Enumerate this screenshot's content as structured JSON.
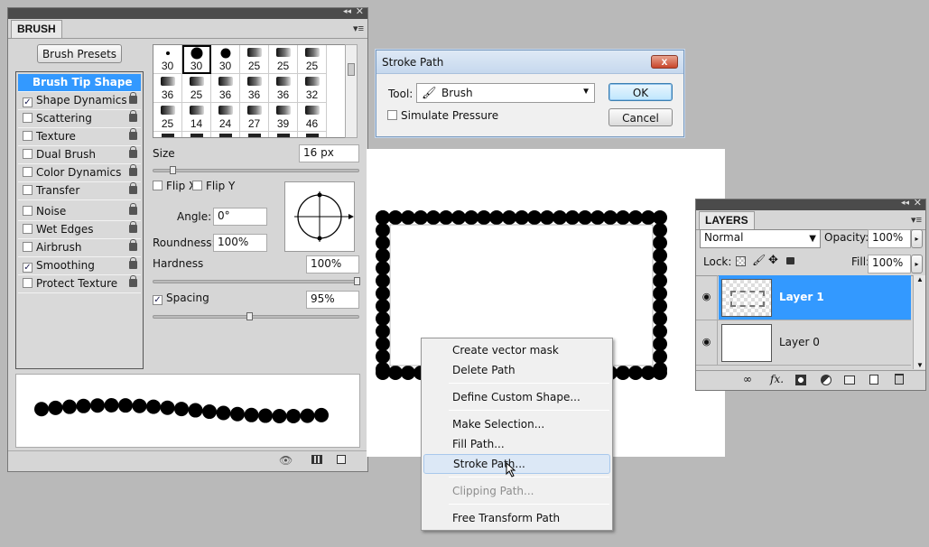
{
  "brush_panel": {
    "tab_label": "BRUSH",
    "presets_button": "Brush Presets",
    "options": [
      {
        "label": "Brush Tip Shape",
        "checked": null,
        "lock": false,
        "selected": true
      },
      {
        "label": "Shape Dynamics",
        "checked": true,
        "lock": true
      },
      {
        "label": "Scattering",
        "checked": false,
        "lock": true
      },
      {
        "label": "Texture",
        "checked": false,
        "lock": true
      },
      {
        "label": "Dual Brush",
        "checked": false,
        "lock": true
      },
      {
        "label": "Color Dynamics",
        "checked": false,
        "lock": true
      },
      {
        "label": "Transfer",
        "checked": false,
        "lock": true
      },
      {
        "label": "Noise",
        "checked": false,
        "lock": true
      },
      {
        "label": "Wet Edges",
        "checked": false,
        "lock": true
      },
      {
        "label": "Airbrush",
        "checked": false,
        "lock": true
      },
      {
        "label": "Smoothing",
        "checked": true,
        "lock": true
      },
      {
        "label": "Protect Texture",
        "checked": false,
        "lock": true
      }
    ],
    "tips_row1": [
      "30",
      "30",
      "30",
      "25",
      "25",
      "25"
    ],
    "tips_row2": [
      "36",
      "25",
      "36",
      "36",
      "36",
      "32"
    ],
    "tips_row3": [
      "25",
      "14",
      "24",
      "27",
      "39",
      "46"
    ],
    "size_label": "Size",
    "size_value": "16 px",
    "size_level": 0.08,
    "flip_x": "Flip X",
    "flip_y": "Flip Y",
    "angle_label": "Angle:",
    "angle_value": "0°",
    "roundness_label": "Roundness:",
    "roundness_value": "100%",
    "hardness_label": "Hardness",
    "hardness_value": "100%",
    "spacing_label": "Spacing",
    "spacing_value": "95%",
    "spacing_checked": true
  },
  "stroke_dialog": {
    "title": "Stroke Path",
    "close": "x",
    "tool_label": "Tool:",
    "tool_value": "Brush",
    "simulate_pressure": "Simulate Pressure",
    "ok": "OK",
    "cancel": "Cancel"
  },
  "context_menu": {
    "items": [
      {
        "label": "Create vector mask",
        "disabled": false
      },
      {
        "label": "Delete Path",
        "disabled": false
      },
      {
        "label": "Define Custom Shape...",
        "disabled": false
      },
      {
        "label": "Make Selection...",
        "disabled": false
      },
      {
        "label": "Fill Path...",
        "disabled": false
      },
      {
        "label": "Stroke Path...",
        "disabled": false,
        "hover": true
      },
      {
        "label": "Clipping Path...",
        "disabled": true
      },
      {
        "label": "Free Transform Path",
        "disabled": false
      }
    ]
  },
  "layers_panel": {
    "tab_label": "LAYERS",
    "blend_mode": "Normal",
    "opacity_label": "Opacity:",
    "opacity_value": "100%",
    "lock_label": "Lock:",
    "fill_label": "Fill:",
    "fill_value": "100%",
    "layers": [
      {
        "name": "Layer 1",
        "selected": true
      },
      {
        "name": "Layer 0",
        "selected": false
      }
    ]
  },
  "colors": {
    "selection": "#3399ff",
    "menu_hover": "#dce8f6"
  }
}
